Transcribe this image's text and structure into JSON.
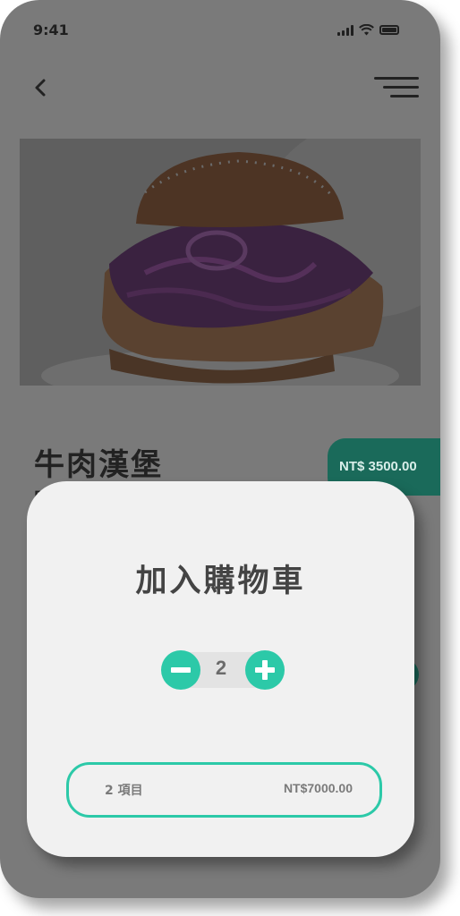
{
  "status_bar": {
    "time": "9:41"
  },
  "colors": {
    "accent": "#2cc9a8",
    "accent_dimmed": "#1a6a5a",
    "overlay": "#7a7a7a",
    "modal_bg": "#f1f1f1"
  },
  "icons": [
    "back-icon",
    "menu-icon",
    "signal-icon",
    "wifi-icon",
    "battery-icon",
    "minus-icon",
    "plus-icon"
  ],
  "product": {
    "name": "牛肉漢堡",
    "subtitle": "開",
    "price": "NT$ 3500.00"
  },
  "modal": {
    "title": "加入購物車",
    "quantity": "2",
    "summary": {
      "item_count": "2 項目",
      "total": "NT$7000.00"
    }
  }
}
